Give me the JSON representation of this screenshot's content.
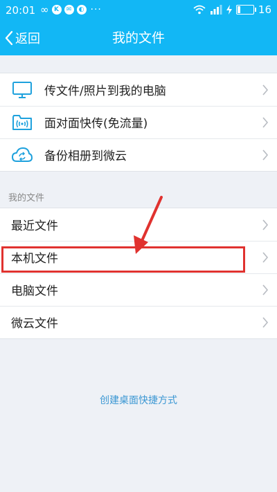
{
  "status": {
    "time": "20:01",
    "infinity_glyph": "∞",
    "k_badge": "K",
    "dots": "···",
    "battery": "16",
    "battery_fraction": 0.16
  },
  "nav": {
    "back_label": "返回",
    "title": "我的文件"
  },
  "top_group": [
    {
      "icon": "monitor-icon",
      "label": "传文件/照片到我的电脑"
    },
    {
      "icon": "wifi-folder-icon",
      "label": "面对面快传(免流量)"
    },
    {
      "icon": "cloud-sync-icon",
      "label": "备份相册到微云"
    }
  ],
  "section_label": "我的文件",
  "files": [
    {
      "label": "最近文件"
    },
    {
      "label": "本机文件"
    },
    {
      "label": "电脑文件"
    },
    {
      "label": "微云文件"
    }
  ],
  "shortcut_link": "创建桌面快捷方式",
  "colors": {
    "accent": "#12b7f5",
    "link": "#3b97d3",
    "annotation": "#e0322f",
    "icon": "#1ea1dd"
  }
}
